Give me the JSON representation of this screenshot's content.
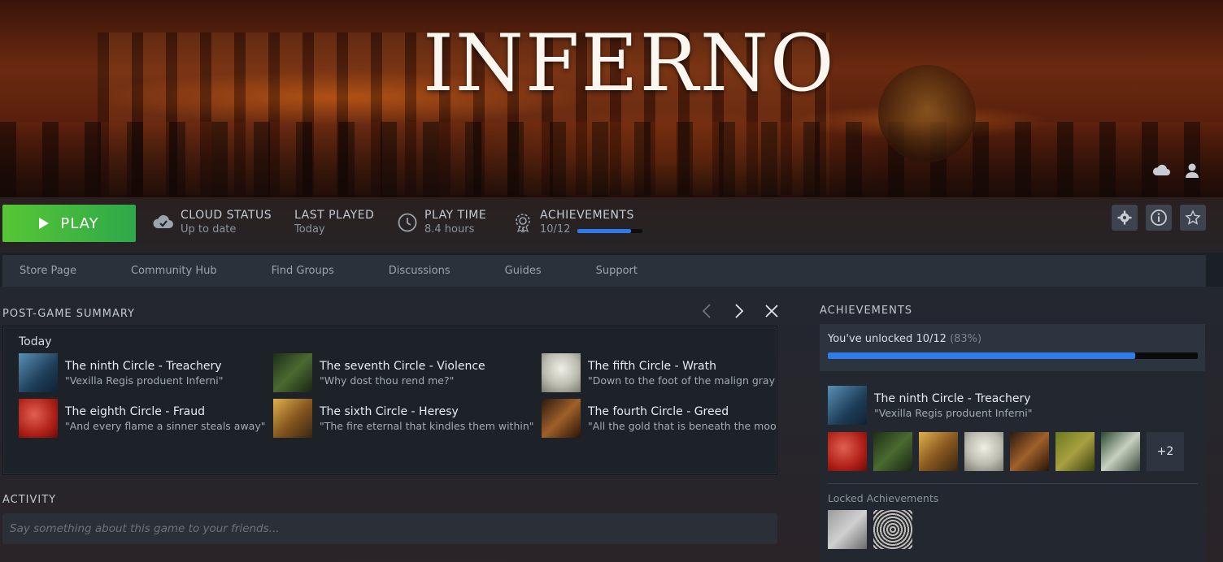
{
  "hero": {
    "logo_text": "INFERNO"
  },
  "actionbar": {
    "play_label": "PLAY",
    "cloud_status": {
      "label": "CLOUD STATUS",
      "value": "Up to date"
    },
    "last_played": {
      "label": "LAST PLAYED",
      "value": "Today"
    },
    "play_time": {
      "label": "PLAY TIME",
      "value": "8.4 hours"
    },
    "achievements": {
      "label": "ACHIEVEMENTS",
      "value": "10/12",
      "progress": 0.83
    }
  },
  "nav": {
    "items": [
      "Store Page",
      "Community Hub",
      "Find Groups",
      "Discussions",
      "Guides",
      "Support"
    ]
  },
  "post_game_summary": {
    "title": "POST-GAME SUMMARY",
    "day": "Today",
    "items": [
      {
        "name": "The ninth Circle - Treachery",
        "quote": "\"Vexilla Regis produent Inferni\"",
        "color": "#3a6a8e"
      },
      {
        "name": "The eighth Circle - Fraud",
        "quote": "\"And every flame a sinner steals away\"",
        "color": "#c0302a"
      },
      {
        "name": "The seventh Circle - Violence",
        "quote": "\"Why dost thou rend me?\"",
        "color": "#3c5a2a"
      },
      {
        "name": "The sixth Circle - Heresy",
        "quote": "\"The fire eternal that kindles them within\"",
        "color": "#b08a3a"
      },
      {
        "name": "The fifth Circle - Wrath",
        "quote": "\"Down to the foot of the malign gray s",
        "color": "#cfcfc0"
      },
      {
        "name": "The fourth Circle - Greed",
        "quote": "\"All the gold that is beneath the moon\"",
        "color": "#6a3a1a"
      }
    ]
  },
  "activity": {
    "title": "ACTIVITY",
    "placeholder": "Say something about this game to your friends..."
  },
  "achievements_panel": {
    "title": "ACHIEVEMENTS",
    "unlocked_text": "You've unlocked 10/12",
    "unlocked_pct": "(83%)",
    "progress": 0.83,
    "featured": {
      "name": "The ninth Circle - Treachery",
      "quote": "\"Vexilla Regis produent Inferni\""
    },
    "more_count": "+2",
    "locked_label": "Locked Achievements"
  },
  "colors": {
    "accent": "#2e7bed",
    "play": "#4cbf3a"
  }
}
